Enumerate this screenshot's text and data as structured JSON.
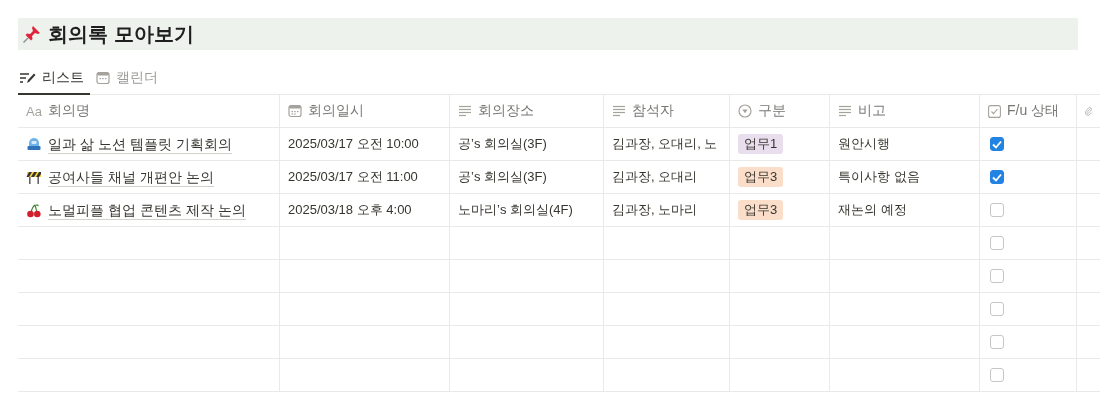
{
  "page": {
    "title": "회의록 모아보기"
  },
  "tabs": [
    {
      "label": "리스트",
      "selected": true
    },
    {
      "label": "캘린더",
      "selected": false
    }
  ],
  "table": {
    "columns": [
      {
        "kind": "title",
        "glyph": "Aa",
        "label": "회의명"
      },
      {
        "kind": "date",
        "label": "회의일시"
      },
      {
        "kind": "text",
        "label": "회의장소"
      },
      {
        "kind": "text",
        "label": "참석자"
      },
      {
        "kind": "select",
        "label": "구분"
      },
      {
        "kind": "text",
        "label": "비고"
      },
      {
        "kind": "checkbox",
        "label": "F/u 상태"
      },
      {
        "kind": "file"
      }
    ],
    "rows": [
      {
        "name": "일과 삶 노션 템플릿 기획회의",
        "date": "2025/03/17 오전 10:00",
        "place": "공’s 회의실(3F)",
        "attendees": "김과장, 오대리, 노",
        "category": {
          "label": "업무1",
          "color": "#e8deee"
        },
        "note": "원안시행",
        "follow_up": true
      },
      {
        "name": "공여사들 채널 개편안 논의",
        "date": "2025/03/17 오전 11:00",
        "place": "공’s 회의실(3F)",
        "attendees": "김과장, 오대리",
        "category": {
          "label": "업무3",
          "color": "#fadec9"
        },
        "note": "특이사항 없음",
        "follow_up": true
      },
      {
        "name": "노멀피플 협업 콘텐츠 제작 논의",
        "date": "2025/03/18 오후 4:00",
        "place": "노마리’s 회의실(4F)",
        "attendees": "김과장, 노마리",
        "category": {
          "label": "업무3",
          "color": "#fadec9"
        },
        "note": "재논의 예정",
        "follow_up": false
      },
      {
        "follow_up": false
      },
      {
        "follow_up": false
      },
      {
        "follow_up": false
      },
      {
        "follow_up": false
      },
      {
        "follow_up": false
      }
    ]
  }
}
